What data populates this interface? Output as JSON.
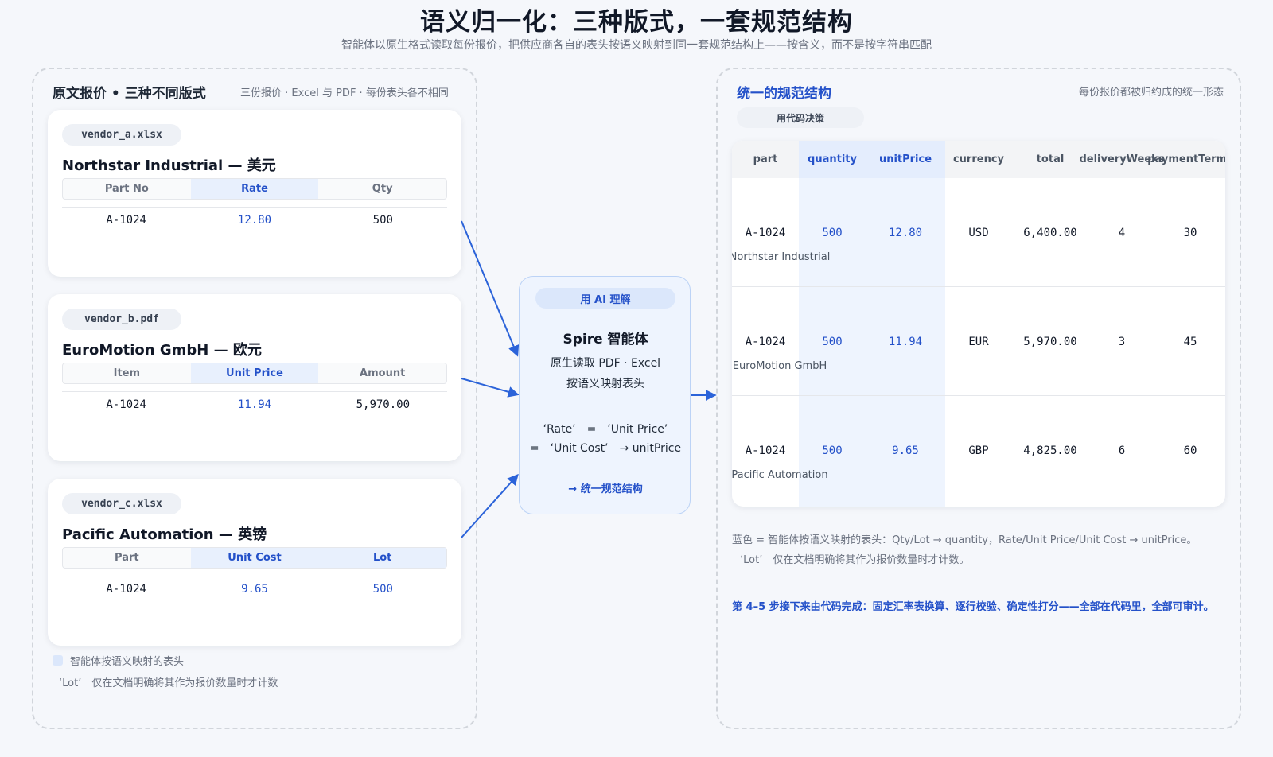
{
  "header": {
    "title": "语义归一化：三种版式，一套规范结构",
    "subtitle": "智能体以原生格式读取每份报价，把供应商各自的表头按语义映射到同一套规范结构上——按含义，而不是按字符串匹配"
  },
  "left_panel": {
    "heading": "原文报价 • 三种不同版式",
    "note": "三份报价 · Excel 与 PDF · 每份表头各不相同",
    "vendors": [
      {
        "file": "vendor_a.xlsx",
        "name": "Northstar Industrial — 美元",
        "headers": [
          "Part No",
          "Rate",
          "Qty"
        ],
        "values": [
          "A-1024",
          "12.80",
          "500"
        ]
      },
      {
        "file": "vendor_b.pdf",
        "name": "EuroMotion GmbH — 欧元",
        "headers": [
          "Item",
          "Unit Price",
          "Amount"
        ],
        "values": [
          "A-1024",
          "11.94",
          "5,970.00"
        ]
      },
      {
        "file": "vendor_c.xlsx",
        "name": "Pacific Automation — 英镑",
        "headers": [
          "Part",
          "Unit Cost",
          "Lot"
        ],
        "values": [
          "A-1024",
          "9.65",
          "500"
        ]
      }
    ],
    "legend": "智能体按语义映射的表头",
    "lot_note": "‘Lot’　仅在文档明确将其作为报价数量时才计数"
  },
  "agent": {
    "chip": "用 AI 理解",
    "name": "Spire 智能体",
    "line1": "原生读取 PDF · Excel",
    "line2": "按语义映射表头",
    "map1": "‘Rate’　=　‘Unit Price’",
    "map2": "=　‘Unit Cost’　→ unitPrice",
    "output": "→ 统一规范结构"
  },
  "right_panel": {
    "heading": "统一的规范结构",
    "note": "每份报价都被归约成的统一形态",
    "chip": "用代码决策",
    "columns": [
      "part",
      "quantity",
      "unitPrice",
      "currency",
      "total",
      "deliveryWeeks",
      "paymentTerms"
    ],
    "rows": [
      {
        "vendor": "Northstar Industrial",
        "cells": [
          "A-1024",
          "500",
          "12.80",
          "USD",
          "6,400.00",
          "4",
          "30"
        ]
      },
      {
        "vendor": "EuroMotion GmbH",
        "cells": [
          "A-1024",
          "500",
          "11.94",
          "EUR",
          "5,970.00",
          "3",
          "45"
        ]
      },
      {
        "vendor": "Pacific Automation",
        "cells": [
          "A-1024",
          "500",
          "9.65",
          "GBP",
          "4,825.00",
          "6",
          "60"
        ]
      }
    ],
    "footnote1": "蓝色 = 智能体按语义映射的表头：Qty/Lot → quantity，Rate/Unit Price/Unit Cost → unitPrice。",
    "footnote2": "‘Lot’　仅在文档明确将其作为报价数量时才计数。",
    "footnote3": "第 4–5 步接下来由代码完成：固定汇率表换算、逐行校验、确定性打分——全部在代码里，全部可审计。"
  },
  "colors": {
    "accent": "#2451c9",
    "arrow": "#2b63d9",
    "highlight": "#eef4fe"
  }
}
